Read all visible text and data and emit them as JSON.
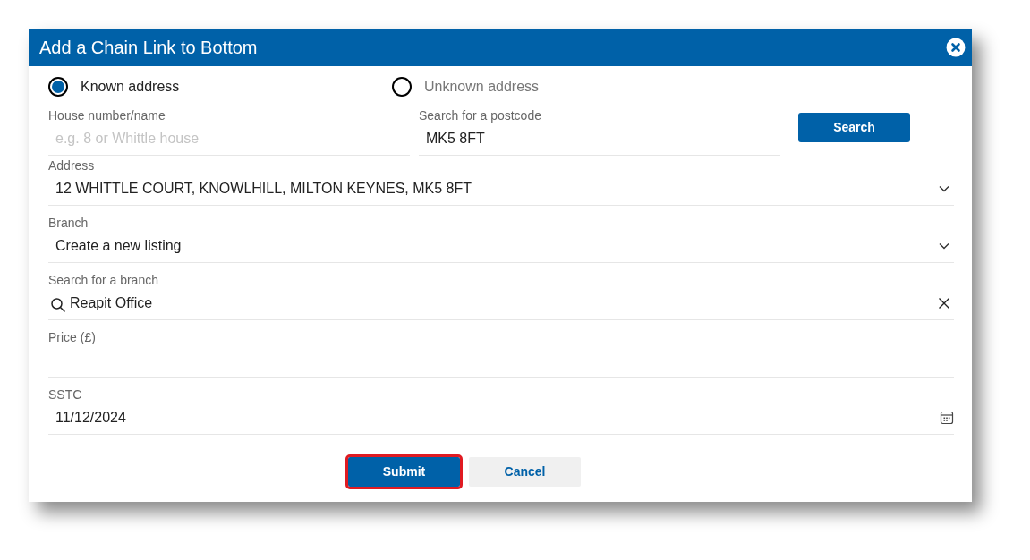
{
  "dialog": {
    "title": "Add a Chain Link to Bottom"
  },
  "address_type": [
    {
      "label": "Known address",
      "selected": true
    },
    {
      "label": "Unknown address",
      "selected": false
    }
  ],
  "top_fields": [
    {
      "kind": "text",
      "label": "House number/name",
      "placeholder": "e.g. 8 or Whittle house"
    },
    {
      "kind": "text",
      "label": "Search for a postcode",
      "value": "MK5 8FT"
    }
  ],
  "search_button": "Search",
  "fields": [
    {
      "kind": "select",
      "label": "Address",
      "value": "12 WHITTLE COURT, KNOWLHILL, MILTON KEYNES, MK5 8FT"
    },
    {
      "kind": "select",
      "label": "Branch",
      "value": "Create a new listing"
    },
    {
      "kind": "search",
      "label": "Search for a branch",
      "value": "Reapit Office"
    },
    {
      "kind": "text",
      "label": "Price (£)"
    },
    {
      "kind": "date",
      "label": "SSTC",
      "value": "11/12/2024"
    }
  ],
  "buttons": [
    {
      "kind": "primary",
      "label": "Submit",
      "highlighted": true
    },
    {
      "kind": "secondary",
      "label": "Cancel",
      "highlighted": false
    }
  ]
}
